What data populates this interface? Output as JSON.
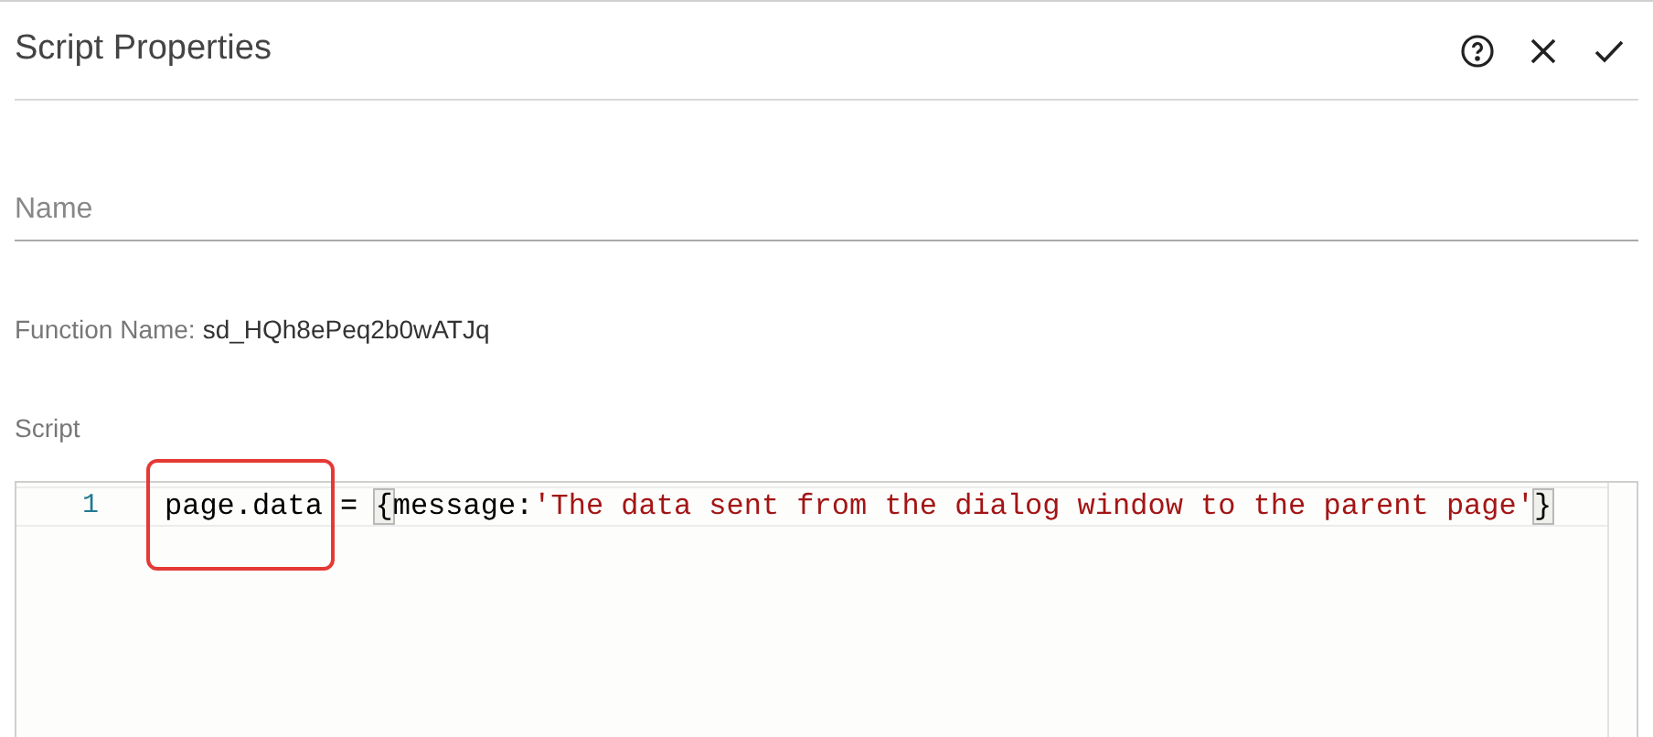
{
  "dialog": {
    "title": "Script Properties",
    "actions": [
      {
        "kind": "help"
      },
      {
        "kind": "close"
      },
      {
        "kind": "confirm"
      }
    ]
  },
  "name_field": {
    "placeholder": "Name"
  },
  "function_name": {
    "label": "Function Name:",
    "value": "sd_HQh8ePeq2b0wATJq"
  },
  "script": {
    "label": "Script",
    "lines": [
      {
        "number": "1",
        "tokens": [
          {
            "text": "page.data",
            "kind": "plain",
            "highlighted": true
          },
          {
            "text": " = ",
            "kind": "plain",
            "highlighted": false
          },
          {
            "text": "{",
            "kind": "bracket",
            "highlighted": false
          },
          {
            "text": "message:",
            "kind": "plain",
            "highlighted": false
          },
          {
            "text": "'The data sent from the dialog window to the parent page'",
            "kind": "string",
            "highlighted": false
          },
          {
            "text": "}",
            "kind": "bracket",
            "highlighted": false
          }
        ]
      }
    ]
  }
}
